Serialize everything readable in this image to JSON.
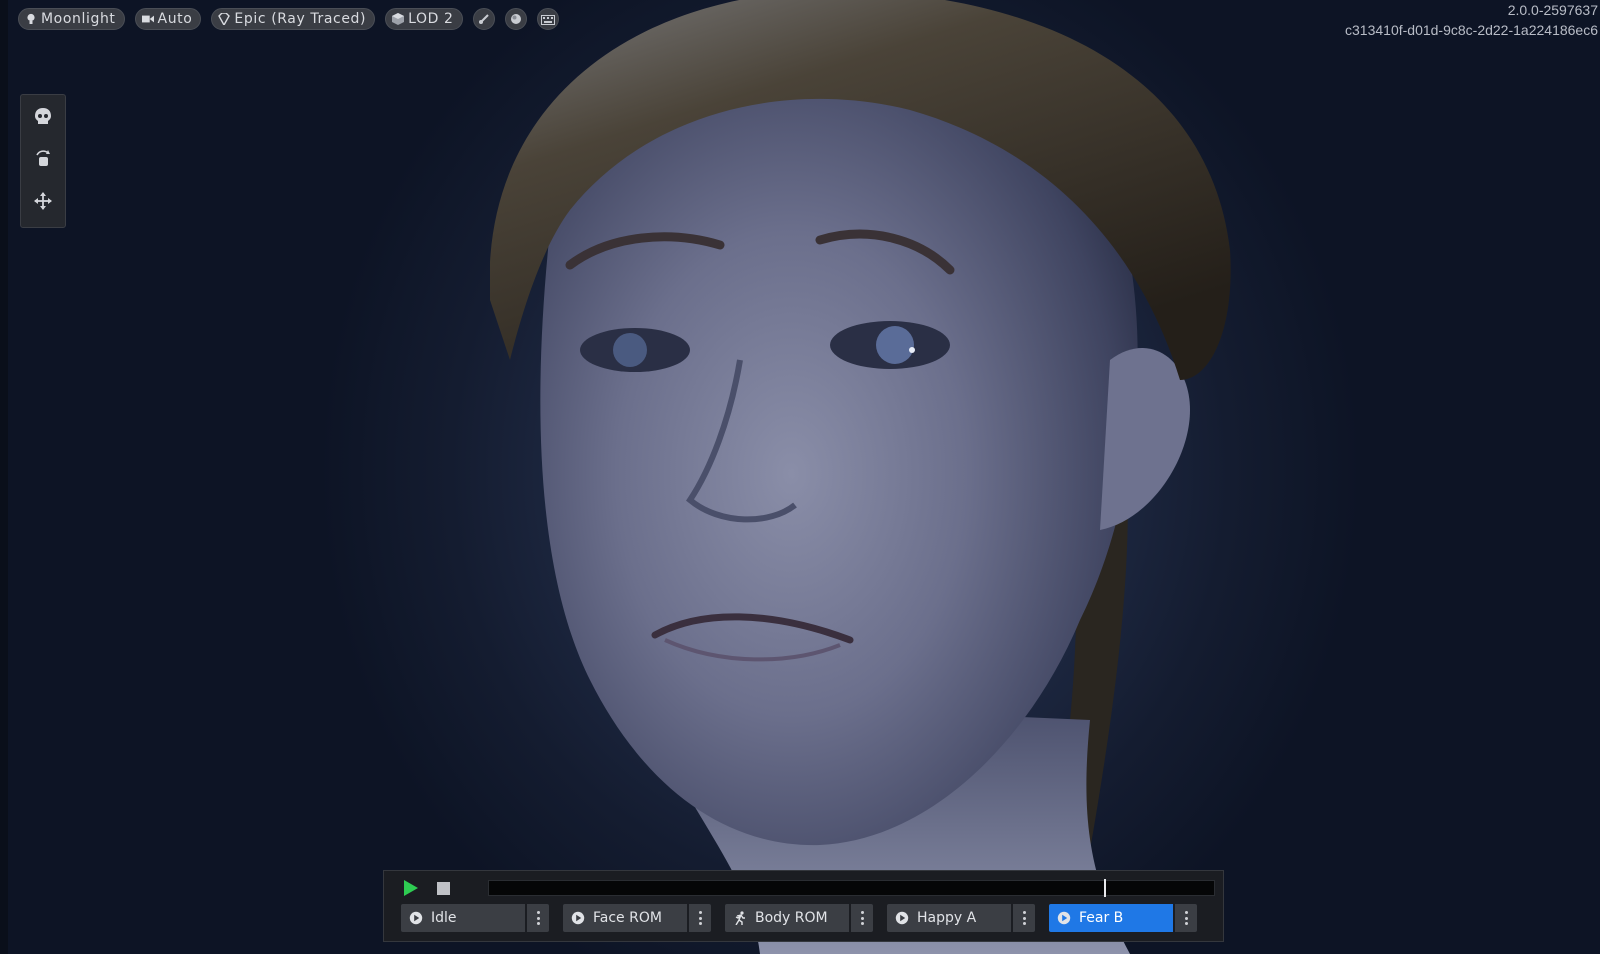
{
  "toolbar": {
    "lighting": "Moonlight",
    "camera": "Auto",
    "quality": "Epic (Ray Traced)",
    "lod": "LOD 2"
  },
  "version": {
    "line1": "2.0.0-2597637",
    "line2": "c313410f-d01d-9c8c-2d22-1a224186ec6"
  },
  "timeline": {
    "progress": 0.85
  },
  "animations": [
    {
      "label": "Idle",
      "icon": "play-circle-icon",
      "active": false
    },
    {
      "label": "Face ROM",
      "icon": "play-circle-icon",
      "active": false
    },
    {
      "label": "Body ROM",
      "icon": "running-figure-icon",
      "active": false
    },
    {
      "label": "Happy A",
      "icon": "play-circle-icon",
      "active": false
    },
    {
      "label": "Fear B",
      "icon": "play-circle-icon",
      "active": true
    }
  ],
  "colors": {
    "accent": "#1f78e6",
    "play": "#2ecc52"
  }
}
